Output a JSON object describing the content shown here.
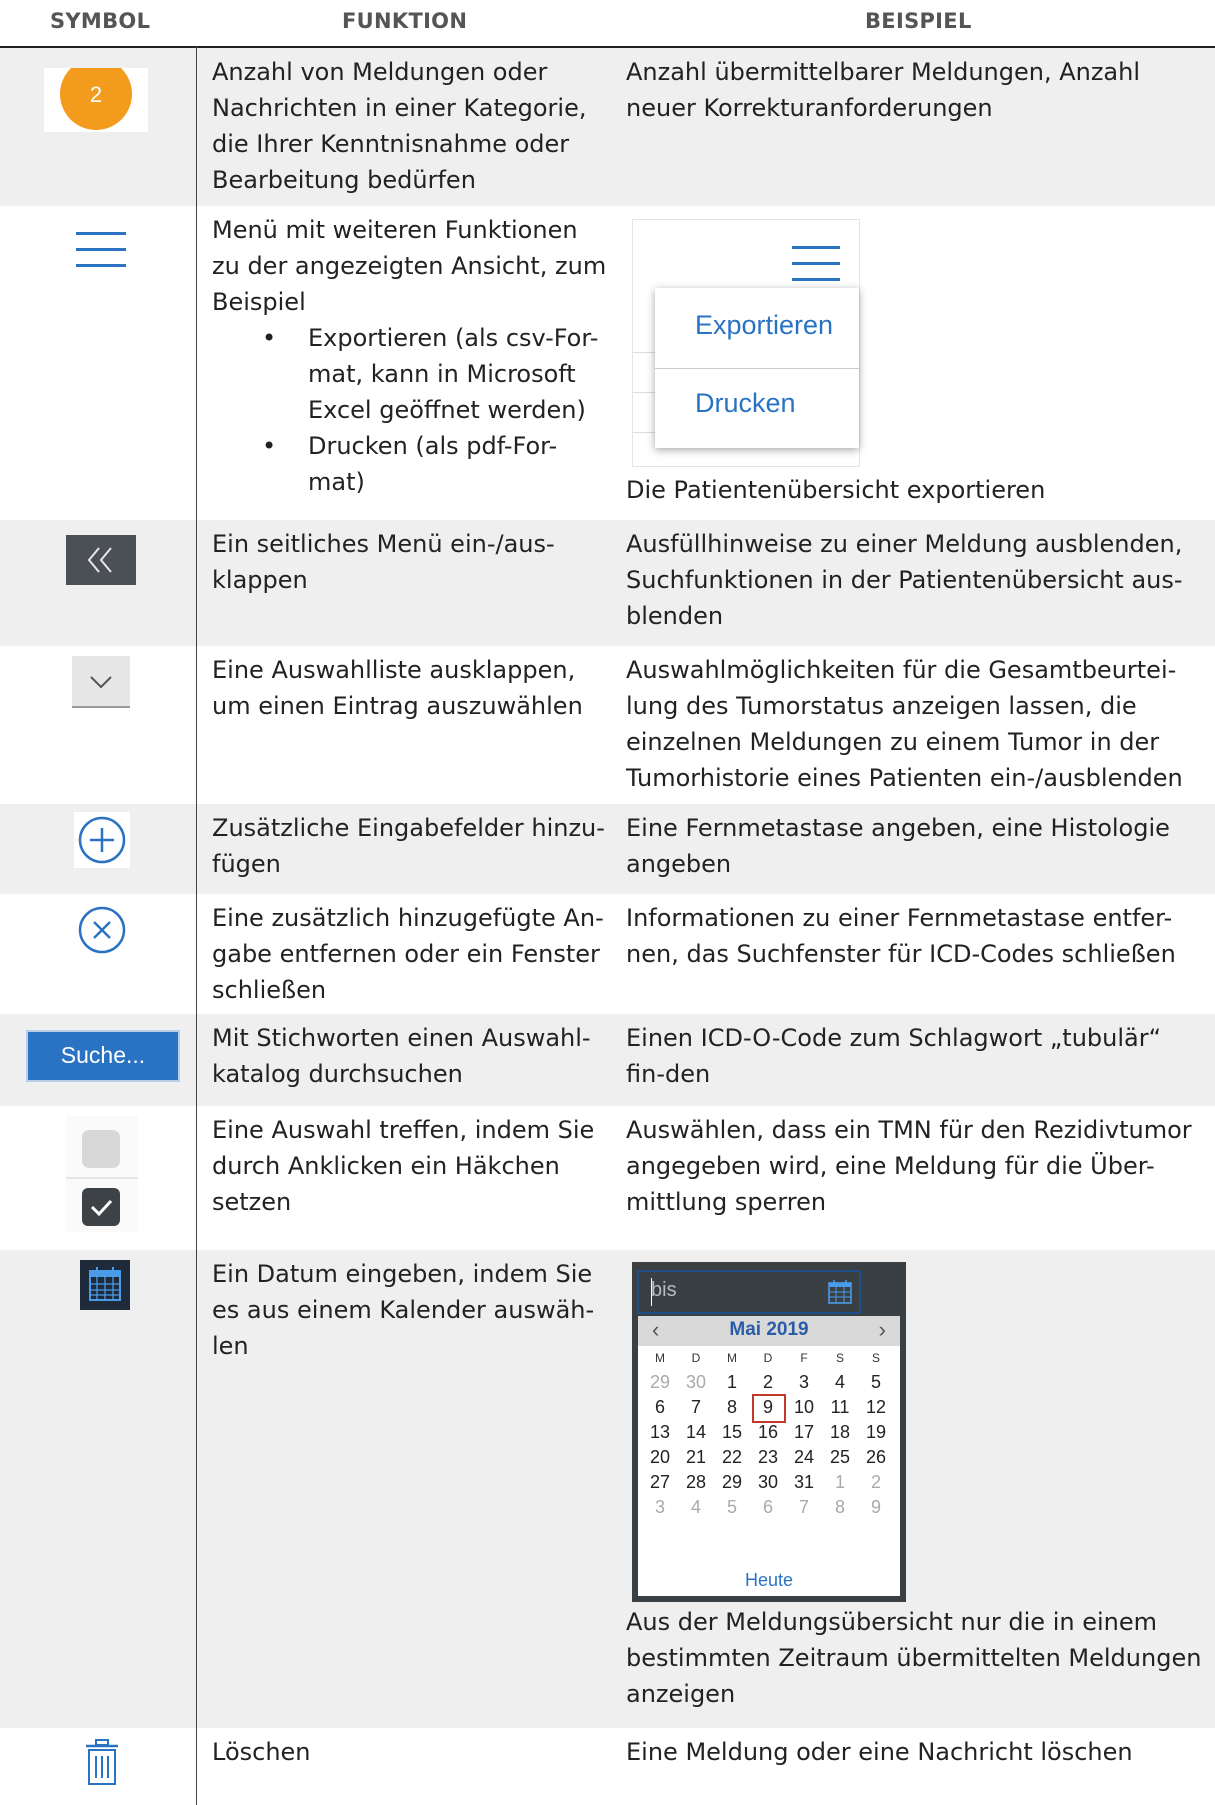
{
  "headers": {
    "symbol": "SYMBOL",
    "funktion": "FUNKTION",
    "beispiel": "BEISPIEL"
  },
  "colors": {
    "badge": "#f29b1d",
    "blue": "#2a73c2",
    "dark_button": "#4a5056",
    "shade": "#efefef"
  },
  "rows": [
    {
      "icon": "count-badge-icon",
      "badge_value": "2",
      "function": "Anzahl von Meldungen oder Nachrichten in einer Kategorie, die Ihrer Kenntnisnahme oder Bearbeitung bedürfen",
      "example": "Anzahl übermittelbarer Meldungen, Anzahl neuer Korrekturanforderungen"
    },
    {
      "icon": "hamburger-menu-icon",
      "function": "Menü mit weiteren Funktionen zu der angezeigten Ansicht, zum Beispiel",
      "bullets": [
        "Exportieren (als csv-For-mat, kann in Microsoft Excel geöffnet werden)",
        "Drucken (als pdf-For-mat)"
      ],
      "menu_items": [
        "Exportieren",
        "Drucken"
      ],
      "example": "Die Patientenübersicht exportieren"
    },
    {
      "icon": "double-chevron-left-icon",
      "function": "Ein seitliches Menü ein-/aus-klappen",
      "example": "Ausfüllhinweise zu einer Meldung ausblenden, Suchfunktionen in der Patientenübersicht aus-blenden"
    },
    {
      "icon": "chevron-down-icon",
      "function": "Eine Auswahlliste ausklappen, um einen Eintrag auszuwählen",
      "example": "Auswahlmöglichkeiten für die Gesamtbeurtei-lung des Tumorstatus anzeigen lassen, die einzelnen Meldungen zu einem Tumor in der Tumorhistorie eines Patienten ein-/ausblenden"
    },
    {
      "icon": "plus-circle-icon",
      "function": "Zusätzliche Eingabefelder hinzu-fügen",
      "example": "Eine Fernmetastase angeben, eine Histologie angeben"
    },
    {
      "icon": "close-circle-icon",
      "function": "Eine zusätzlich hinzugefügte An-gabe entfernen oder ein Fenster schließen",
      "example": "Informationen zu einer Fernmetastase entfer-nen, das Suchfenster für ICD-Codes schließen"
    },
    {
      "icon": "search-button-icon",
      "button_label": "Suche...",
      "function": "Mit Stichworten einen Auswahl-katalog durchsuchen",
      "example": "Einen ICD-O-Code zum Schlagwort „tubulär“ fin-den"
    },
    {
      "icon": "checkbox-icon",
      "function": "Eine Auswahl treffen, indem Sie durch Anklicken ein Häkchen setzen",
      "example": "Auswählen, dass ein TMN für den Rezidivtumor angegeben wird, eine Meldung für die Über-mittlung sperren"
    },
    {
      "icon": "calendar-icon",
      "function": "Ein Datum eingeben, indem Sie es aus einem Kalender auswäh-len",
      "example": "Aus der Meldungsübersicht nur die in einem bestimmten Zeitraum übermittelten Meldungen anzeigen",
      "calendar": {
        "placeholder": "bis",
        "month": "Mai 2019",
        "weekdays": [
          "M",
          "D",
          "M",
          "D",
          "F",
          "S",
          "S"
        ],
        "weeks": [
          [
            "29",
            "30",
            "1",
            "2",
            "3",
            "4",
            "5"
          ],
          [
            "6",
            "7",
            "8",
            "9",
            "10",
            "11",
            "12"
          ],
          [
            "13",
            "14",
            "15",
            "16",
            "17",
            "18",
            "19"
          ],
          [
            "20",
            "21",
            "22",
            "23",
            "24",
            "25",
            "26"
          ],
          [
            "27",
            "28",
            "29",
            "30",
            "31",
            "1",
            "2"
          ],
          [
            "3",
            "4",
            "5",
            "6",
            "7",
            "8",
            "9"
          ]
        ],
        "selected": "9",
        "today_label": "Heute"
      }
    },
    {
      "icon": "trash-icon",
      "function": "Löschen",
      "example": "Eine Meldung oder eine Nachricht löschen"
    }
  ]
}
